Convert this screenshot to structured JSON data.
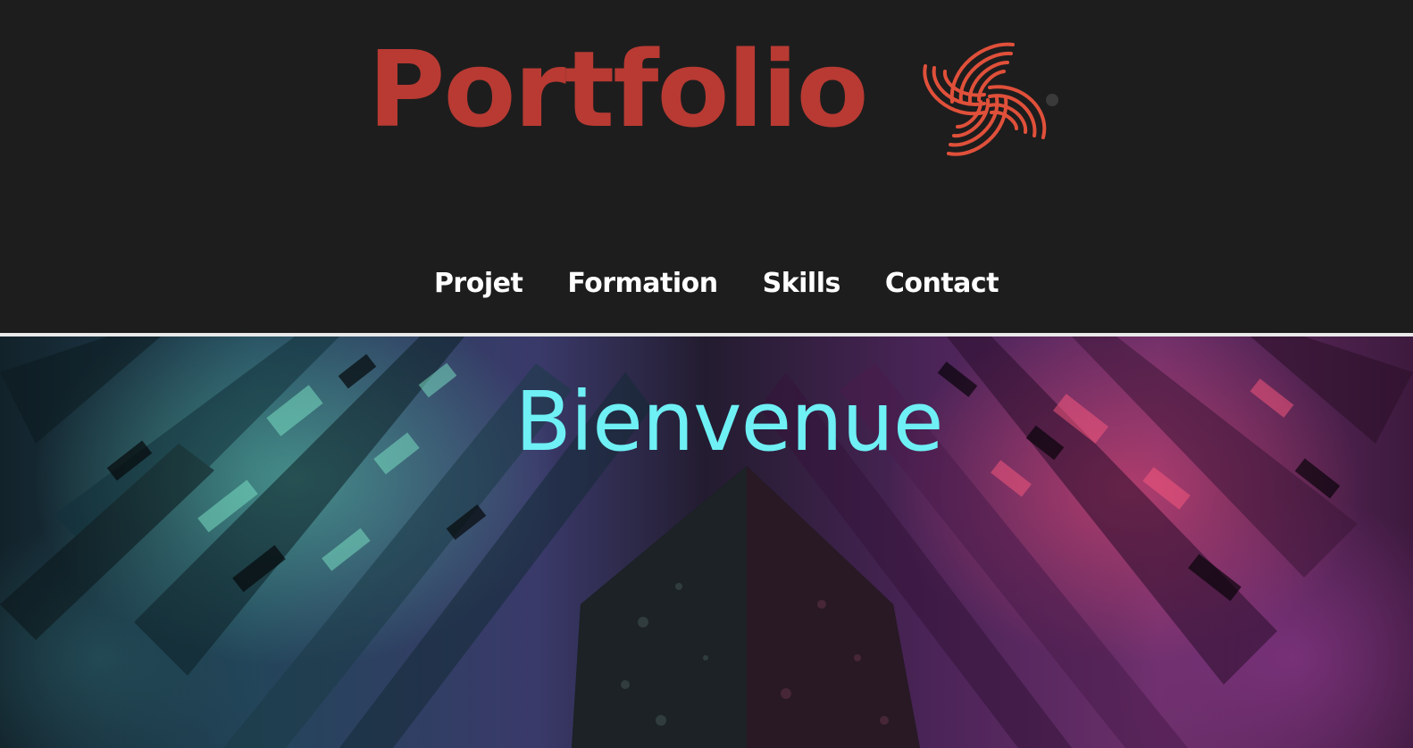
{
  "header": {
    "brand_title": "Portfolio",
    "logo_icon": "swirl-logo-icon",
    "brand_color": "#b83a33",
    "logo_color": "#e0503a",
    "background": "#1d1d1d"
  },
  "nav": {
    "items": [
      {
        "label": "Projet"
      },
      {
        "label": "Formation"
      },
      {
        "label": "Skills"
      },
      {
        "label": "Contact"
      }
    ],
    "text_color": "#ffffff"
  },
  "hero": {
    "title": "Bienvenue",
    "title_color": "#6ef0f5",
    "background_image": "abstract-crystal-tunnel-image"
  }
}
